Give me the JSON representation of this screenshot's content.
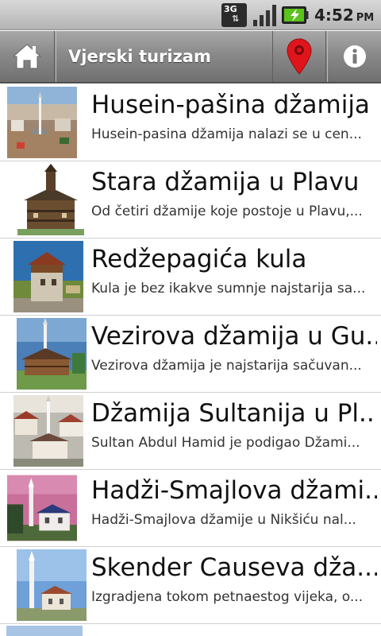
{
  "status_bar": {
    "network": "3G",
    "time": "4:52",
    "ampm": "PM"
  },
  "action_bar": {
    "title": "Vjerski turizam",
    "home_icon": "home-icon",
    "map_icon": "map-pin-icon",
    "info_icon": "info-icon",
    "accent_color": "#e0151c"
  },
  "items": [
    {
      "title": "Husein-pašina džamija",
      "desc": "Husein-pasina džamija nalazi se u cen..."
    },
    {
      "title": "Stara džamija u Plavu",
      "desc": "Od četiri džamije koje postoje u Plavu,..."
    },
    {
      "title": "Redžepagića kula",
      "desc": "Kula je bez ikakve sumnje najstarija sa..."
    },
    {
      "title": "Vezirova džamija u Gu...",
      "desc": "Vezirova džamija je najstarija sačuvan..."
    },
    {
      "title": "Džamija Sultanija u Pl...",
      "desc": "Sultan Abdul Hamid je podigao Džami..."
    },
    {
      "title": "Hadži-Smajlova džami...",
      "desc": "Hadži-Smajlova džamije u Nikšiću nal..."
    },
    {
      "title": "Skender Causeva dža...",
      "desc": "Izgradjena tokom petnaestog vijeka, o..."
    }
  ]
}
